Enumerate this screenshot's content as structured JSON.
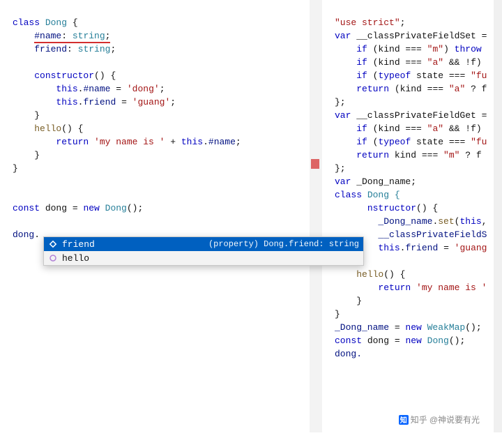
{
  "left": {
    "l1": {
      "kw_class": "class",
      "cls_name": "Dong",
      "brace": " {"
    },
    "l2": {
      "hash_name": "#name",
      "colon": ": ",
      "type": "string",
      "semi": ";"
    },
    "l3": {
      "prop": "friend",
      "colon": ": ",
      "type": "string",
      "semi": ";"
    },
    "l5": {
      "ctor": "constructor",
      "rest": "() {"
    },
    "l6": {
      "this": "this",
      "dot": ".",
      "field": "#name",
      "eq": " = ",
      "str": "'dong'",
      "semi": ";"
    },
    "l7": {
      "this": "this",
      "dot": ".",
      "field": "friend",
      "eq": " = ",
      "str": "'guang'",
      "semi": ";"
    },
    "l8": {
      "brace": "}"
    },
    "l9": {
      "fn": "hello",
      "rest": "() {"
    },
    "l10": {
      "ret": "return",
      "sp": " ",
      "str": "'my name is '",
      "plus": " + ",
      "this": "this",
      "dot": ".",
      "field": "#name",
      "semi": ";"
    },
    "l11": {
      "brace": "}"
    },
    "l12": {
      "brace2": "}"
    },
    "l15": {
      "const": "const",
      "name": " dong = ",
      "new": "new",
      "cls": " Dong",
      "rest": "();"
    },
    "l17": {
      "obj": "dong",
      "dot": "."
    }
  },
  "right": {
    "l1": {
      "str": "\"use strict\"",
      "semi": ";"
    },
    "l2": {
      "var": "var",
      "name": " __classPrivateFieldSet ="
    },
    "l3": {
      "if": "if",
      "rest": " (kind === ",
      "str": "\"m\"",
      "rest2": ") ",
      "throw": "throw"
    },
    "l4": {
      "if": "if",
      "rest": " (kind === ",
      "str": "\"a\"",
      "rest2": " && !f)"
    },
    "l5": {
      "if": "if",
      "rest": " (",
      "typeof": "typeof",
      "rest2": " state === ",
      "str": "\"fu"
    },
    "l6": {
      "ret": "return",
      "rest": " (kind === ",
      "str": "\"a\"",
      "rest2": " ? f"
    },
    "l7": {
      "brace": "};"
    },
    "l8": {
      "var": "var",
      "name": " __classPrivateFieldGet ="
    },
    "l9": {
      "if": "if",
      "rest": " (kind === ",
      "str": "\"a\"",
      "rest2": " && !f)"
    },
    "l10": {
      "if": "if",
      "rest": " (",
      "typeof": "typeof",
      "rest2": " state === ",
      "str": "\"fu"
    },
    "l11": {
      "ret": "return",
      "rest": " kind === ",
      "str": "\"m\"",
      "rest2": " ? f"
    },
    "l12": {
      "brace": "};"
    },
    "l13": {
      "var": "var",
      "name": " _Dong_name;"
    },
    "l14": {
      "kw_class": "class",
      "cls_name": " Dong {"
    },
    "l15": {
      "ctor": "nstructor",
      "rest": "() {"
    },
    "l16": {
      "id": "_Dong_name",
      "dot": ".",
      "fn": "set",
      "rest": "(",
      "this": "this",
      "comma": ","
    },
    "l17": {
      "id": "__classPrivateFieldS"
    },
    "l18": {
      "this": "this",
      "dot": ".",
      "field": "friend",
      "eq": " = ",
      "str": "'guang"
    },
    "l19": {
      "brace": "}"
    },
    "l20": {
      "fn": "hello",
      "rest": "() {"
    },
    "l21": {
      "ret": "return",
      "sp": " ",
      "str": "'my name is '"
    },
    "l22": {
      "brace": "}"
    },
    "l23": {
      "brace2": "}"
    },
    "l24": {
      "id": "_Dong_name",
      "eq": " = ",
      "new": "new",
      "cls": " WeakMap",
      "rest": "();"
    },
    "l25": {
      "const": "const",
      "name": " dong = ",
      "new": "new",
      "cls": " Dong",
      "rest": "();"
    },
    "l26_partial": "dong."
  },
  "autocomplete": {
    "items": [
      {
        "kind": "field",
        "label": "friend",
        "detail": "(property) Dong.friend: string",
        "selected": true
      },
      {
        "kind": "method",
        "label": "hello",
        "detail": "",
        "selected": false
      }
    ]
  },
  "watermark": {
    "label": "知乎",
    "author": "@神说要有光"
  }
}
